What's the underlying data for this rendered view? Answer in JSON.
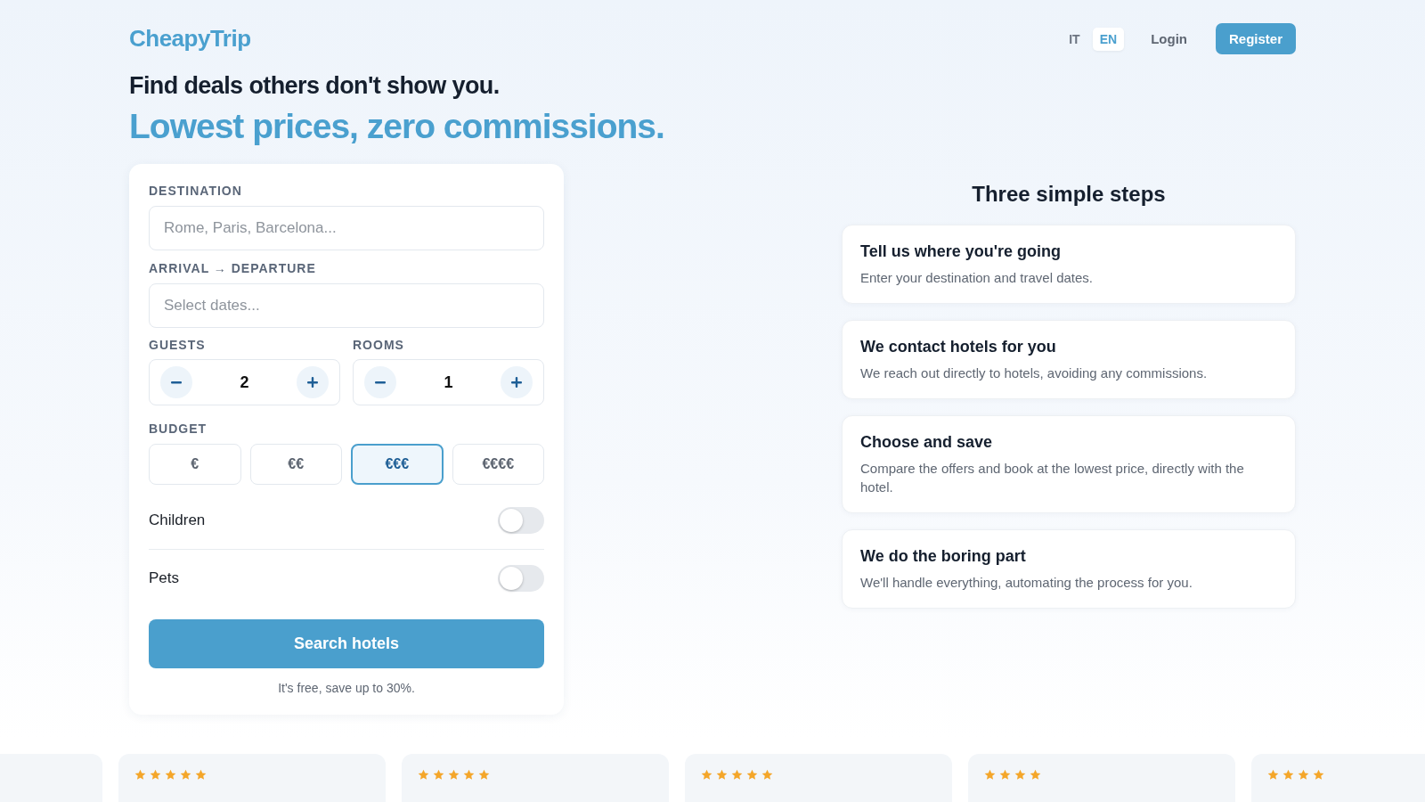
{
  "header": {
    "logo": "CheapyTrip",
    "languages": [
      {
        "label": "IT",
        "selected": false
      },
      {
        "label": "EN",
        "selected": true
      }
    ],
    "login": "Login",
    "register": "Register"
  },
  "hero": {
    "title": "Find deals others don't show you.",
    "subtitle": "Lowest prices, zero commissions."
  },
  "search_form": {
    "destination": {
      "label": "DESTINATION",
      "placeholder": "Rome, Paris, Barcelona..."
    },
    "dates": {
      "label": "ARRIVAL → DEPARTURE",
      "placeholder": "Select dates..."
    },
    "counters": [
      {
        "label": "GUESTS",
        "value": "2"
      },
      {
        "label": "ROOMS",
        "value": "1"
      }
    ],
    "budget": {
      "label": "BUDGET",
      "options": [
        {
          "label": "€",
          "selected": false
        },
        {
          "label": "€€",
          "selected": false
        },
        {
          "label": "€€€",
          "selected": true
        },
        {
          "label": "€€€€",
          "selected": false
        }
      ]
    },
    "toggles": [
      {
        "label": "Children",
        "on": false
      },
      {
        "label": "Pets",
        "on": false
      }
    ],
    "submit": "Search hotels",
    "note": "It's free, save up to 30%."
  },
  "steps": {
    "title": "Three simple steps",
    "items": [
      {
        "title": "Tell us where you're going",
        "text": "Enter your destination and travel dates."
      },
      {
        "title": "We contact hotels for you",
        "text": "We reach out directly to hotels, avoiding any commissions."
      },
      {
        "title": "Choose and save",
        "text": "Compare the offers and book at the lowest price, directly with the hotel."
      },
      {
        "title": "We do the boring part",
        "text": "We'll handle everything, automating the process for you."
      }
    ]
  },
  "reviews": [
    {
      "stars": 5
    },
    {
      "stars": 5
    },
    {
      "stars": 5
    },
    {
      "stars": 4
    },
    {
      "stars": 4
    }
  ]
}
